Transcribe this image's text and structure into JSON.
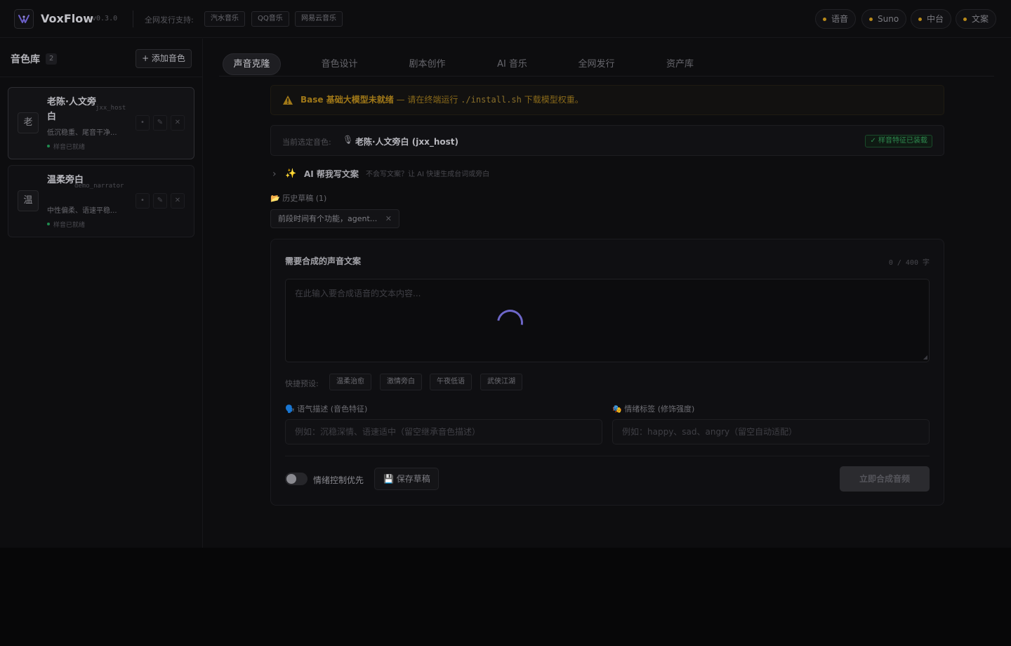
{
  "header": {
    "app_name": "VoxFlow",
    "version": "v0.3.0",
    "distribution_label": "全网发行支持:",
    "platforms": [
      "汽水音乐",
      "QQ音乐",
      "网易云音乐"
    ],
    "status": [
      {
        "label": "语音",
        "color": "#b98a1a"
      },
      {
        "label": "Suno",
        "color": "#b98a1a"
      },
      {
        "label": "中台",
        "color": "#b98a1a"
      },
      {
        "label": "文案",
        "color": "#b98a1a"
      }
    ]
  },
  "sidebar": {
    "title": "音色库",
    "count": "2",
    "add_label": "+ 添加音色",
    "voices": [
      {
        "avatar": "老",
        "name": "老陈·人文旁白",
        "code": "jxx_host",
        "desc": "低沉稳重、尾音干净...",
        "status": "样音已就绪",
        "selected": true
      },
      {
        "avatar": "温",
        "name": "温柔旁白",
        "code": "demo_narrator",
        "desc": "中性偏柔、语速平稳...",
        "status": "样音已就绪",
        "selected": false
      }
    ],
    "action_icons": [
      "dot-icon",
      "edit-icon",
      "close-icon"
    ]
  },
  "tabs": [
    "声音克隆",
    "音色设计",
    "剧本创作",
    "AI 音乐",
    "全网发行",
    "资产库"
  ],
  "active_tab": "声音克隆",
  "warning": {
    "bold": "Base 基础大模型未就绪",
    "text_before": " — 请在终端运行 ",
    "code": "./install.sh",
    "text_after": " 下载模型权重。"
  },
  "current_voice": {
    "label": "当前选定音色:",
    "name": "老陈·人文旁白 (jxx_host)",
    "badge": "✓ 样音特征已装载"
  },
  "ai_helper": {
    "title": "AI 帮我写文案",
    "subtitle": "不会写文案？让 AI 快速生成台词或旁白"
  },
  "history": {
    "title": "📂 历史草稿 (1)",
    "items": [
      "前段时间有个功能，agent..."
    ]
  },
  "editor": {
    "title": "需要合成的声音文案",
    "count": "0 / 400 字",
    "placeholder": "在此输入要合成语音的文本内容...",
    "presets_label": "快捷预设:",
    "presets": [
      "温柔治愈",
      "激情旁白",
      "午夜低语",
      "武侠江湖"
    ],
    "tone_label": "🗣️ 语气描述 (音色特征)",
    "tone_placeholder": "例如：沉稳深情、语速适中（留空继承音色描述）",
    "emotion_label": "🎭 情绪标签 (修饰强度)",
    "emotion_placeholder": "例如：happy、sad、angry（留空自动适配）",
    "toggle_label": "情绪控制优先",
    "toggle_on": false,
    "save_label": "💾 保存草稿",
    "synth_label": "立即合成音频"
  }
}
